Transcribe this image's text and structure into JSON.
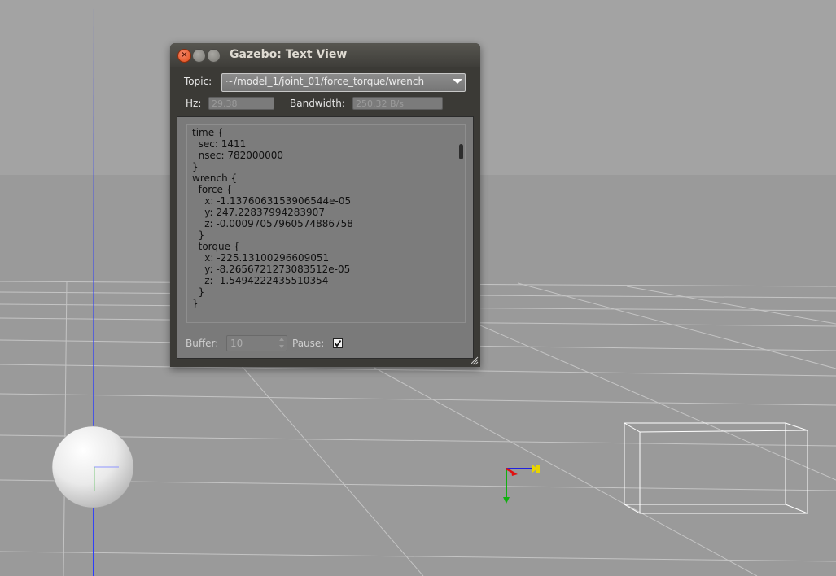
{
  "window": {
    "title": "Gazebo: Text View",
    "close_glyph": "×",
    "min_glyph": "–",
    "max_glyph": "□"
  },
  "topic": {
    "label": "Topic:",
    "value": "~/model_1/joint_01/force_torque/wrench"
  },
  "stats": {
    "hz_label": "Hz:",
    "hz_value": "29.38",
    "bandwidth_label": "Bandwidth:",
    "bandwidth_value": "250.32 B/s"
  },
  "message": {
    "text": "time {\n  sec: 1411\n  nsec: 782000000\n}\nwrench {\n  force {\n    x: -1.1376063153906544e-05\n    y: 247.22837994283907\n    z: -0.00097057960574886758\n  }\n  torque {\n    x: -225.13100296609051\n    y: -8.2656721273083512e-05\n    z: -1.5494222435510354\n  }\n}"
  },
  "controls": {
    "buffer_label": "Buffer:",
    "buffer_value": "10",
    "pause_label": "Pause:",
    "pause_checked": true
  },
  "icons": {
    "close": "close-icon",
    "minimize": "minimize-icon",
    "maximize": "maximize-icon",
    "dropdown": "chevron-down-icon",
    "checkmark": "checkmark-icon",
    "resize": "resize-grip-icon",
    "axes": "axis-gizmo-icon"
  },
  "colors": {
    "sky": "#a3a3a3",
    "ground": "#9a9a9a",
    "window_bg": "#3b3a36",
    "close_button": "#e2501b",
    "axis_x": "#2020e0",
    "axis_y": "#e01010",
    "axis_z": "#10b010",
    "marker": "#e8d400"
  }
}
